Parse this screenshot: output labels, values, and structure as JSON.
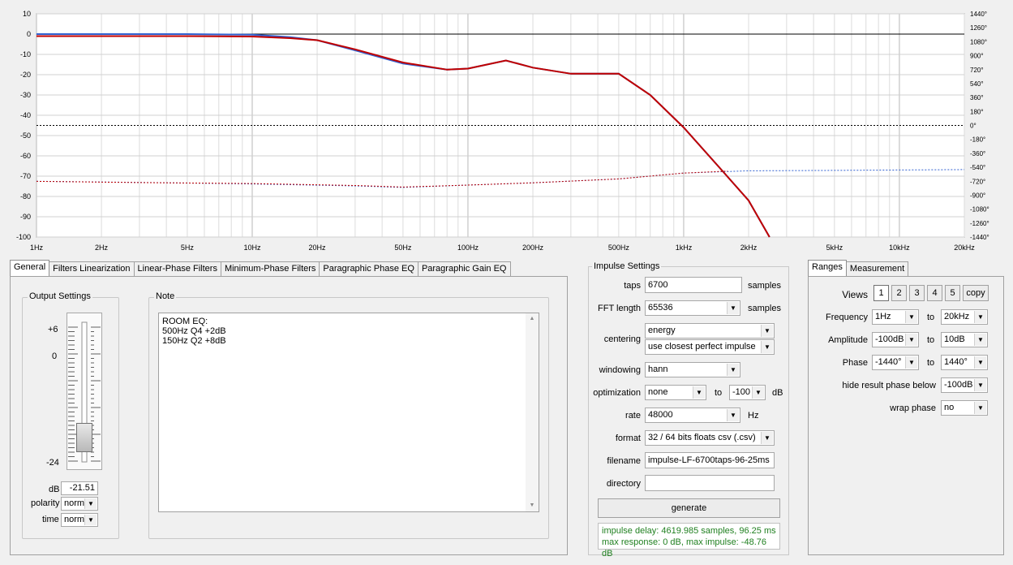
{
  "chart": {
    "left_ticks": [
      "10",
      "0",
      "-10",
      "-20",
      "-30",
      "-40",
      "-50",
      "-60",
      "-70",
      "-80",
      "-90",
      "-100"
    ],
    "right_ticks": [
      "1440°",
      "1260°",
      "1080°",
      "900°",
      "720°",
      "540°",
      "360°",
      "180°",
      "0°",
      "-180°",
      "-360°",
      "-540°",
      "-720°",
      "-900°",
      "-1080°",
      "-1260°",
      "-1440°"
    ],
    "x_ticks": [
      "1Hz",
      "2Hz",
      "5Hz",
      "10Hz",
      "20Hz",
      "50Hz",
      "100Hz",
      "200Hz",
      "500Hz",
      "1kHz",
      "2kHz",
      "5kHz",
      "10kHz",
      "20kHz"
    ],
    "colors": {
      "blue": "#3060d0",
      "red": "#c00000",
      "grid": "#c8c8c8",
      "ref": "#000000"
    }
  },
  "chart_data": {
    "type": "line",
    "xlabel": "",
    "ylabel": "",
    "xscale": "log",
    "xlim": [
      1,
      20000
    ],
    "ylim": [
      -100,
      10
    ],
    "y2lim": [
      -1440,
      1440
    ],
    "grid": true,
    "reference_lines": {
      "magnitude_db": 0,
      "phase_deg": 0
    },
    "series": [
      {
        "kind": "magnitude",
        "color": "#3060d0",
        "x": [
          1,
          5,
          10,
          15,
          20,
          30,
          50,
          80,
          100,
          150,
          200,
          300,
          500,
          700,
          1000,
          1500,
          2000,
          2500
        ],
        "y": [
          0,
          0,
          -0.3,
          -1.5,
          -3,
          -8,
          -14.5,
          -17.5,
          -17,
          -13,
          -16.5,
          -19.5,
          -19.5,
          -30,
          -46,
          -67,
          -82,
          -100
        ]
      },
      {
        "kind": "magnitude",
        "color": "#c00000",
        "x": [
          1,
          5,
          10,
          15,
          20,
          30,
          50,
          80,
          100,
          150,
          200,
          300,
          500,
          700,
          1000,
          1500,
          2000,
          2500
        ],
        "y": [
          -1,
          -1,
          -1.2,
          -2,
          -3,
          -7.5,
          -14,
          -17.5,
          -17,
          -13,
          -16.5,
          -19.5,
          -19.5,
          -30,
          -46,
          -67,
          -82,
          -100
        ]
      },
      {
        "kind": "phase",
        "color": "#3060d0",
        "x": [
          1,
          3,
          10,
          30,
          50,
          100,
          200,
          500,
          1000,
          2000,
          5000,
          10000,
          20000
        ],
        "y": [
          -720,
          -735,
          -755,
          -780,
          -800,
          -770,
          -740,
          -690,
          -615,
          -585,
          -580,
          -575,
          -570
        ]
      },
      {
        "kind": "phase",
        "color": "#c00000",
        "x": [
          1,
          3,
          10,
          30,
          50,
          100,
          200,
          500,
          1000,
          1600
        ],
        "y": [
          -722,
          -737,
          -750,
          -775,
          -795,
          -770,
          -740,
          -690,
          -615,
          -590
        ]
      }
    ]
  },
  "left_tabs": [
    "General",
    "Filters Linearization",
    "Linear-Phase Filters",
    "Minimum-Phase Filters",
    "Paragraphic Phase EQ",
    "Paragraphic Gain EQ"
  ],
  "output": {
    "title": "Output Settings",
    "scale_top": "+6",
    "scale_zero": "0",
    "scale_bottom": "-24",
    "db_label": "dB",
    "db_value": "-21.51",
    "slider_fraction": 0.91,
    "polarity_label": "polarity",
    "polarity_value": "norm",
    "time_label": "time",
    "time_value": "norm"
  },
  "note": {
    "title": "Note",
    "lines": [
      "ROOM EQ:",
      "500Hz Q4 +2dB",
      "150Hz Q2 +8dB"
    ]
  },
  "impulse": {
    "title": "Impulse Settings",
    "taps_label": "taps",
    "taps_value": "6700",
    "taps_unit": "samples",
    "fft_label": "FFT length",
    "fft_value": "65536",
    "fft_unit": "samples",
    "centering_label": "centering",
    "centering_value": "energy",
    "centering_value2": "use closest perfect impulse",
    "windowing_label": "windowing",
    "windowing_value": "hann",
    "optimization_label": "optimization",
    "optimization_value": "none",
    "optimization_to": "to",
    "optimization_db": "-100",
    "optimization_unit": "dB",
    "rate_label": "rate",
    "rate_value": "48000",
    "rate_unit": "Hz",
    "format_label": "format",
    "format_value": "32 / 64 bits floats csv (.csv)",
    "filename_label": "filename",
    "filename_value": "impulse-LF-6700taps-96-25ms",
    "directory_label": "directory",
    "directory_value": "",
    "generate_label": "generate",
    "status_line1": "impulse delay: 4619.985 samples, 96.25 ms",
    "status_line2": "max response: 0 dB, max impulse: -48.76 dB"
  },
  "right_tabs": [
    "Ranges",
    "Measurement"
  ],
  "ranges": {
    "views_label": "Views",
    "views": [
      "1",
      "2",
      "3",
      "4",
      "5"
    ],
    "copy_label": "copy",
    "selected_view": "1",
    "frequency_label": "Frequency",
    "frequency_from": "1Hz",
    "frequency_to": "20kHz",
    "amplitude_label": "Amplitude",
    "amplitude_from": "-100dB",
    "amplitude_to": "10dB",
    "phase_label": "Phase",
    "phase_from": "-1440°",
    "phase_to": "1440°",
    "to_label": "to",
    "hide_label": "hide result phase below",
    "hide_value": "-100dB",
    "wrap_label": "wrap phase",
    "wrap_value": "no"
  }
}
